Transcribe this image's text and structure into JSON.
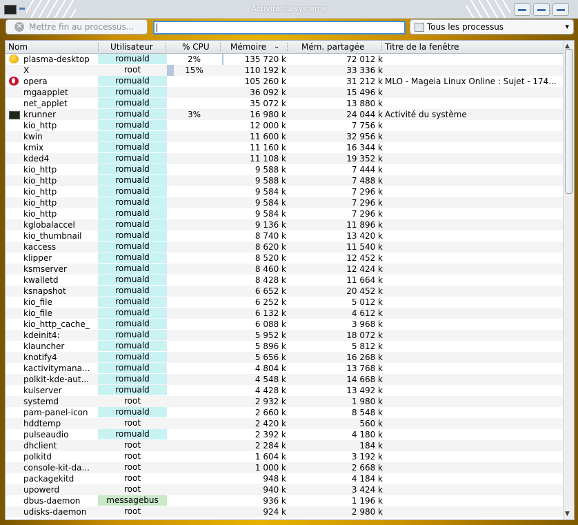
{
  "window": {
    "title": "Activité du système"
  },
  "toolbar": {
    "kill_label": "Mettre fin au processus...",
    "search_value": "",
    "filter_selected": "Tous les processus"
  },
  "columns": {
    "name": "Nom",
    "user": "Utilisateur",
    "cpu": "% CPU",
    "memory": "Mémoire",
    "shared": "Mém. partagée",
    "window_title": "Titre de la fenêtre"
  },
  "sort": {
    "column": "memory",
    "direction": "descending"
  },
  "processes": [
    {
      "name": "plasma-desktop",
      "user": "romuald",
      "cpu": "2%",
      "mem": "135 720 k",
      "shm": "72 012 k",
      "title": "",
      "icon": "plasma-icon"
    },
    {
      "name": "X",
      "user": "root",
      "cpu": "15%",
      "mem": "110 192 k",
      "shm": "33 336 k",
      "title": "",
      "icon": ""
    },
    {
      "name": "opera",
      "user": "romuald",
      "cpu": "",
      "mem": "105 260 k",
      "shm": "31 212 k",
      "title": "MLO - Mageia Linux Online : Sujet - 174...",
      "icon": "opera-icon"
    },
    {
      "name": "mgaapplet",
      "user": "romuald",
      "cpu": "",
      "mem": "36 092 k",
      "shm": "15 496 k",
      "title": "",
      "icon": ""
    },
    {
      "name": "net_applet",
      "user": "romuald",
      "cpu": "",
      "mem": "35 072 k",
      "shm": "13 880 k",
      "title": "",
      "icon": ""
    },
    {
      "name": "krunner",
      "user": "romuald",
      "cpu": "3%",
      "mem": "16 980 k",
      "shm": "24 044 k",
      "title": "Activité du système",
      "icon": "krunner-icon"
    },
    {
      "name": "kio_http",
      "user": "romuald",
      "cpu": "",
      "mem": "12 000 k",
      "shm": "7 756 k",
      "title": "",
      "icon": ""
    },
    {
      "name": "kwin",
      "user": "romuald",
      "cpu": "",
      "mem": "11 600 k",
      "shm": "32 956 k",
      "title": "",
      "icon": ""
    },
    {
      "name": "kmix",
      "user": "romuald",
      "cpu": "",
      "mem": "11 160 k",
      "shm": "16 344 k",
      "title": "",
      "icon": ""
    },
    {
      "name": "kded4",
      "user": "romuald",
      "cpu": "",
      "mem": "11 108 k",
      "shm": "19 352 k",
      "title": "",
      "icon": ""
    },
    {
      "name": "kio_http",
      "user": "romuald",
      "cpu": "",
      "mem": "9 588 k",
      "shm": "7 444 k",
      "title": "",
      "icon": ""
    },
    {
      "name": "kio_http",
      "user": "romuald",
      "cpu": "",
      "mem": "9 588 k",
      "shm": "7 488 k",
      "title": "",
      "icon": ""
    },
    {
      "name": "kio_http",
      "user": "romuald",
      "cpu": "",
      "mem": "9 584 k",
      "shm": "7 296 k",
      "title": "",
      "icon": ""
    },
    {
      "name": "kio_http",
      "user": "romuald",
      "cpu": "",
      "mem": "9 584 k",
      "shm": "7 296 k",
      "title": "",
      "icon": ""
    },
    {
      "name": "kio_http",
      "user": "romuald",
      "cpu": "",
      "mem": "9 584 k",
      "shm": "7 296 k",
      "title": "",
      "icon": ""
    },
    {
      "name": "kglobalaccel",
      "user": "romuald",
      "cpu": "",
      "mem": "9 136 k",
      "shm": "11 896 k",
      "title": "",
      "icon": ""
    },
    {
      "name": "kio_thumbnail",
      "user": "romuald",
      "cpu": "",
      "mem": "8 740 k",
      "shm": "13 420 k",
      "title": "",
      "icon": ""
    },
    {
      "name": "kaccess",
      "user": "romuald",
      "cpu": "",
      "mem": "8 620 k",
      "shm": "11 540 k",
      "title": "",
      "icon": ""
    },
    {
      "name": "klipper",
      "user": "romuald",
      "cpu": "",
      "mem": "8 520 k",
      "shm": "12 452 k",
      "title": "",
      "icon": ""
    },
    {
      "name": "ksmserver",
      "user": "romuald",
      "cpu": "",
      "mem": "8 460 k",
      "shm": "12 424 k",
      "title": "",
      "icon": ""
    },
    {
      "name": "kwalletd",
      "user": "romuald",
      "cpu": "",
      "mem": "8 428 k",
      "shm": "11 664 k",
      "title": "",
      "icon": ""
    },
    {
      "name": "ksnapshot",
      "user": "romuald",
      "cpu": "",
      "mem": "6 652 k",
      "shm": "20 452 k",
      "title": "",
      "icon": ""
    },
    {
      "name": "kio_file",
      "user": "romuald",
      "cpu": "",
      "mem": "6 252 k",
      "shm": "5 012 k",
      "title": "",
      "icon": ""
    },
    {
      "name": "kio_file",
      "user": "romuald",
      "cpu": "",
      "mem": "6 132 k",
      "shm": "4 612 k",
      "title": "",
      "icon": ""
    },
    {
      "name": "kio_http_cache_",
      "user": "romuald",
      "cpu": "",
      "mem": "6 088 k",
      "shm": "3 968 k",
      "title": "",
      "icon": ""
    },
    {
      "name": "kdeinit4:",
      "user": "romuald",
      "cpu": "",
      "mem": "5 952 k",
      "shm": "18 072 k",
      "title": "",
      "icon": ""
    },
    {
      "name": "klauncher",
      "user": "romuald",
      "cpu": "",
      "mem": "5 896 k",
      "shm": "5 812 k",
      "title": "",
      "icon": ""
    },
    {
      "name": "knotify4",
      "user": "romuald",
      "cpu": "",
      "mem": "5 656 k",
      "shm": "16 268 k",
      "title": "",
      "icon": ""
    },
    {
      "name": "kactivitymana...",
      "user": "romuald",
      "cpu": "",
      "mem": "4 804 k",
      "shm": "13 768 k",
      "title": "",
      "icon": ""
    },
    {
      "name": "polkit-kde-aut...",
      "user": "romuald",
      "cpu": "",
      "mem": "4 548 k",
      "shm": "14 668 k",
      "title": "",
      "icon": ""
    },
    {
      "name": "kuiserver",
      "user": "romuald",
      "cpu": "",
      "mem": "4 428 k",
      "shm": "13 492 k",
      "title": "",
      "icon": ""
    },
    {
      "name": "systemd",
      "user": "root",
      "cpu": "",
      "mem": "2 932 k",
      "shm": "1 980 k",
      "title": "",
      "icon": ""
    },
    {
      "name": "pam-panel-icon",
      "user": "romuald",
      "cpu": "",
      "mem": "2 660 k",
      "shm": "8 548 k",
      "title": "",
      "icon": ""
    },
    {
      "name": "hddtemp",
      "user": "root",
      "cpu": "",
      "mem": "2 420 k",
      "shm": "560 k",
      "title": "",
      "icon": ""
    },
    {
      "name": "pulseaudio",
      "user": "romuald",
      "cpu": "",
      "mem": "2 392 k",
      "shm": "4 180 k",
      "title": "",
      "icon": ""
    },
    {
      "name": "dhclient",
      "user": "root",
      "cpu": "",
      "mem": "2 284 k",
      "shm": "184 k",
      "title": "",
      "icon": ""
    },
    {
      "name": "polkitd",
      "user": "root",
      "cpu": "",
      "mem": "1 604 k",
      "shm": "3 192 k",
      "title": "",
      "icon": ""
    },
    {
      "name": "console-kit-da...",
      "user": "root",
      "cpu": "",
      "mem": "1 000 k",
      "shm": "2 668 k",
      "title": "",
      "icon": ""
    },
    {
      "name": "packagekitd",
      "user": "root",
      "cpu": "",
      "mem": "948 k",
      "shm": "4 184 k",
      "title": "",
      "icon": ""
    },
    {
      "name": "upowerd",
      "user": "root",
      "cpu": "",
      "mem": "940 k",
      "shm": "3 424 k",
      "title": "",
      "icon": ""
    },
    {
      "name": "dbus-daemon",
      "user": "messagebus",
      "cpu": "",
      "mem": "936 k",
      "shm": "1 196 k",
      "title": "",
      "icon": ""
    },
    {
      "name": "udisks-daemon",
      "user": "root",
      "cpu": "",
      "mem": "924 k",
      "shm": "2 980 k",
      "title": "",
      "icon": ""
    }
  ]
}
